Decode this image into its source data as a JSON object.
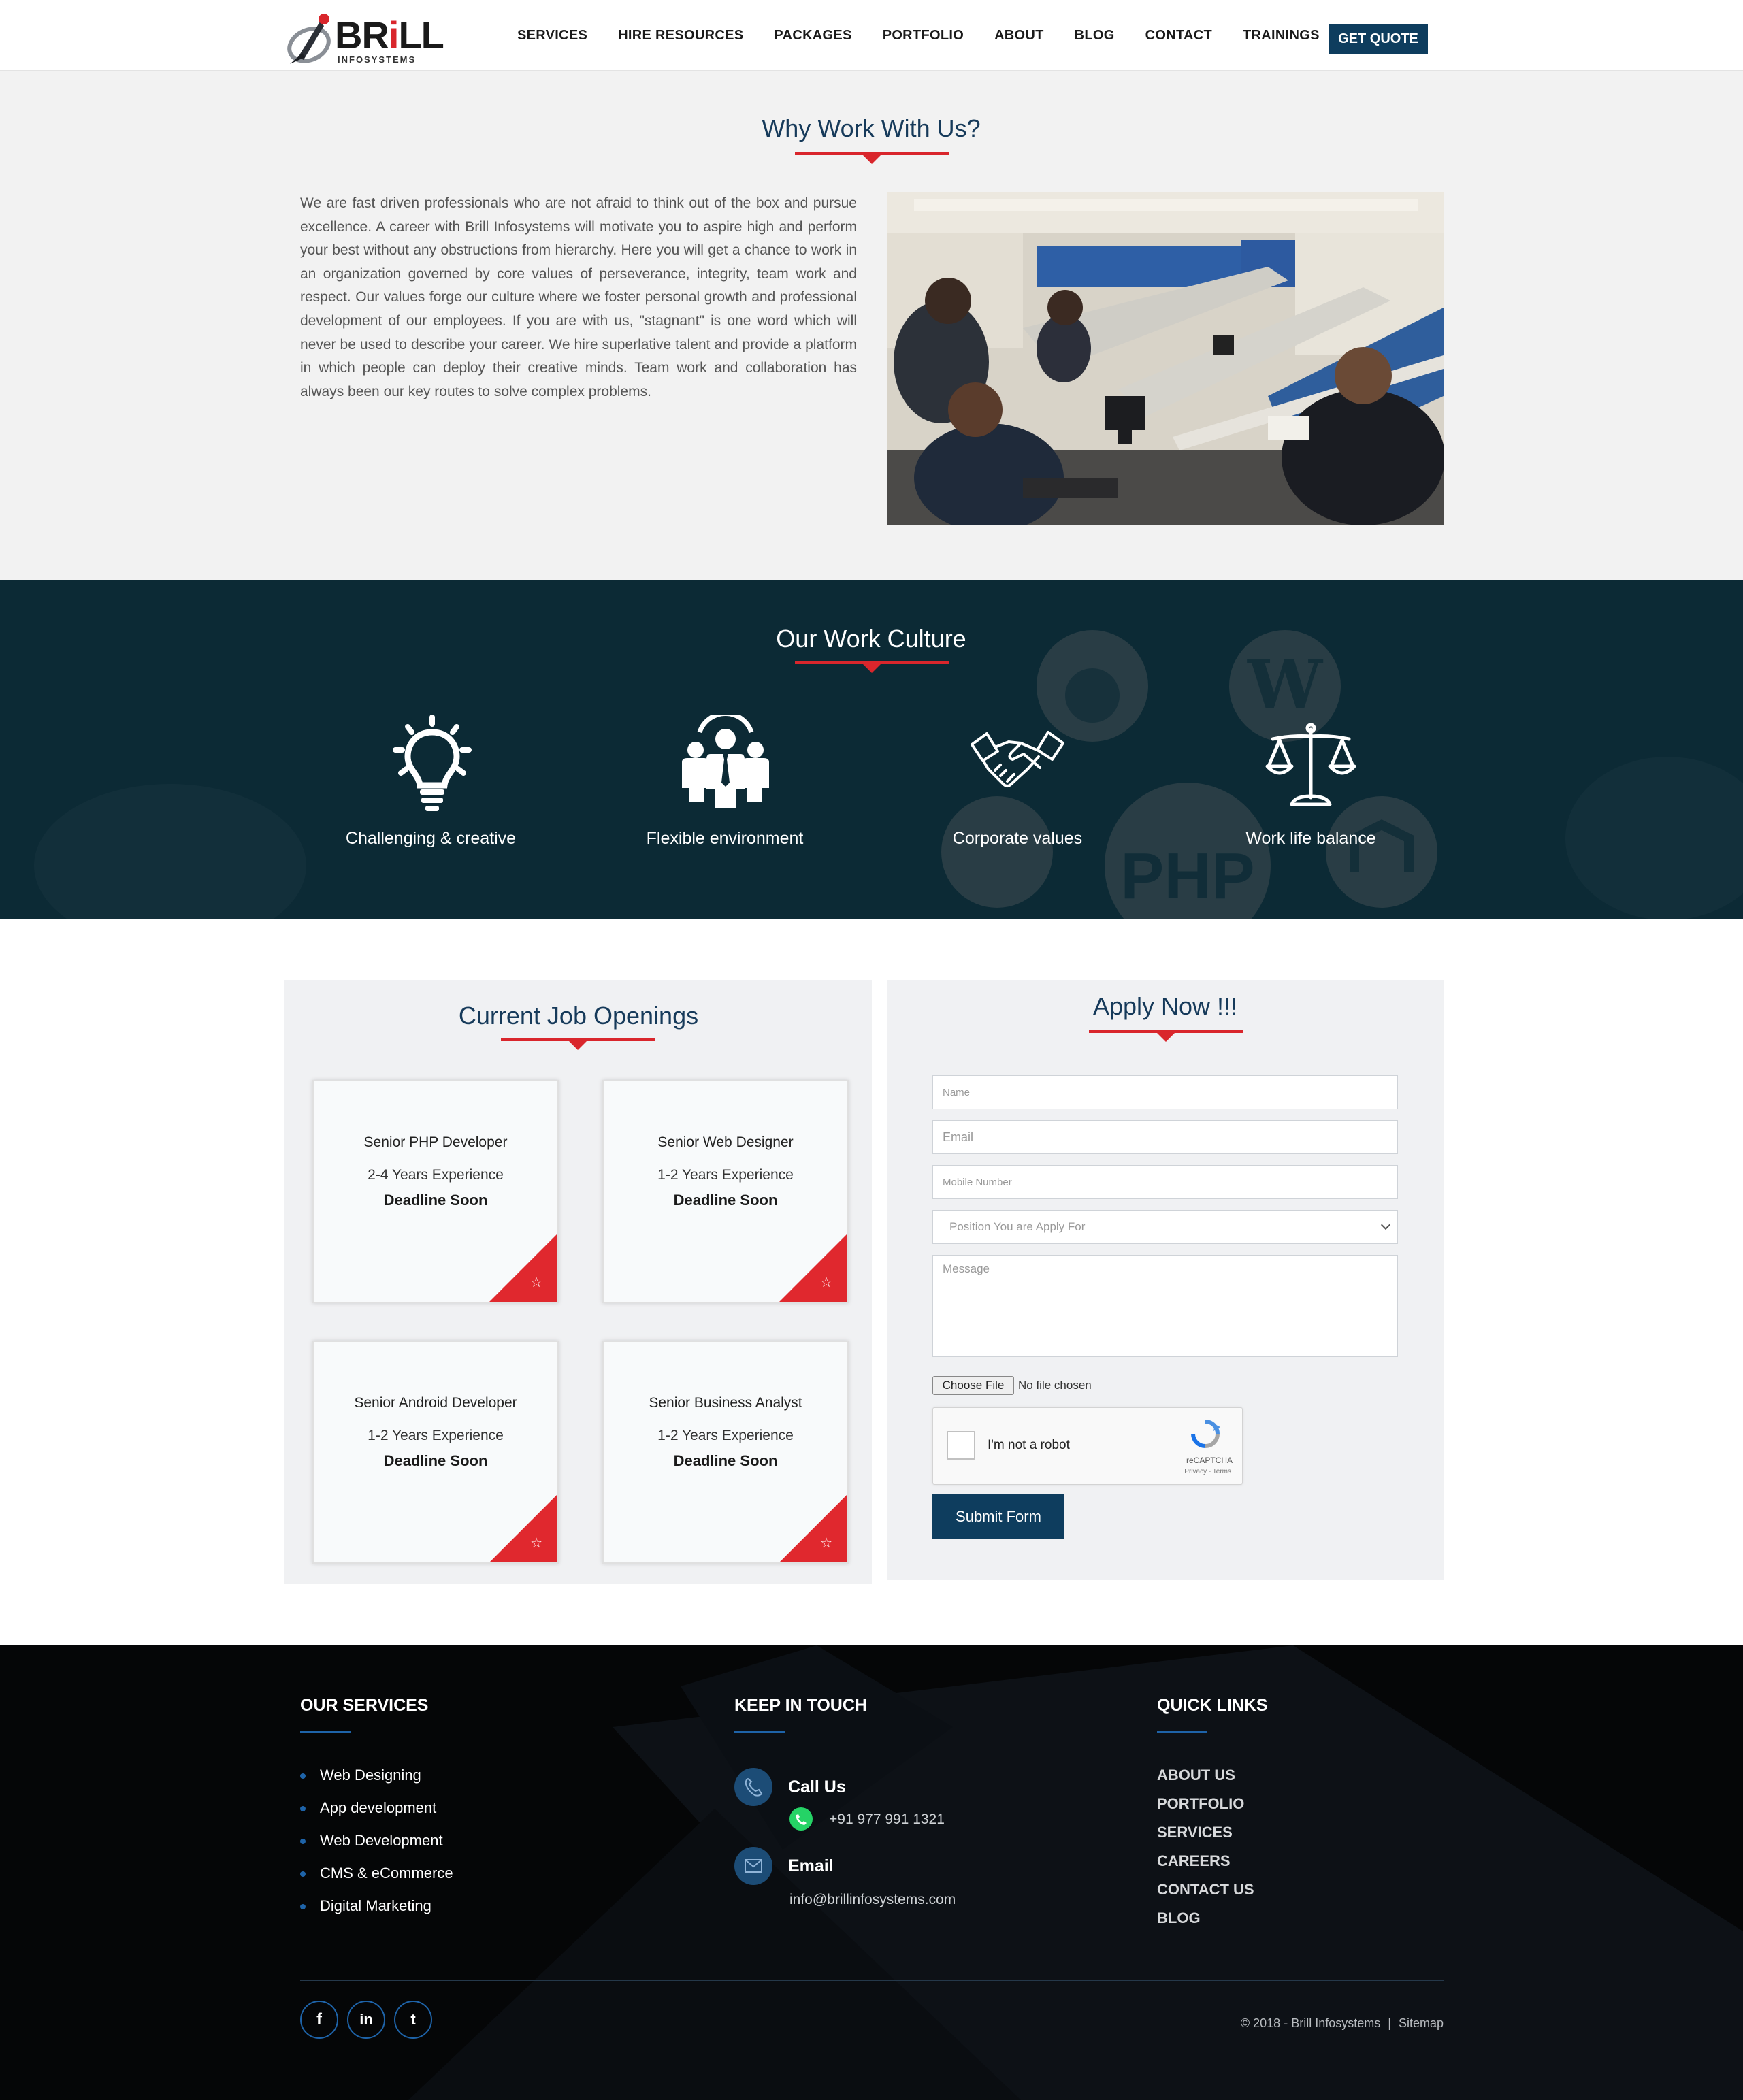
{
  "header": {
    "logo_text_main": "BR",
    "logo_text_accent": "i",
    "logo_text_end": "LL",
    "logo_subtitle": "INFOSYSTEMS",
    "nav": [
      "SERVICES",
      "HIRE RESOURCES",
      "PACKAGES",
      "PORTFOLIO",
      "ABOUT",
      "BLOG",
      "CONTACT",
      "TRAININGS"
    ],
    "cta": "GET QUOTE"
  },
  "why": {
    "title": "Why Work With Us?",
    "body": "We are fast driven professionals who are not afraid to think out of the box and pursue excellence. A career with Brill Infosystems will motivate you to aspire high and perform your best without any obstructions from hierarchy. Here you will get a chance to work in an organization governed by core values of perseverance, integrity, team work and respect. Our values forge our culture where we foster personal growth and professional development of our employees. If you are with us, \"stagnant\" is one word which will never be used to describe your career. We hire superlative talent and provide a platform in which people can deploy their creative minds. Team work and collaboration has always been our key routes to solve complex problems."
  },
  "culture": {
    "title": "Our Work Culture",
    "items": [
      {
        "label": "Challenging & creative",
        "icon": "lightbulb-icon"
      },
      {
        "label": "Flexible environment",
        "icon": "team-icon"
      },
      {
        "label": "Corporate values",
        "icon": "handshake-icon"
      },
      {
        "label": "Work life balance",
        "icon": "scales-icon"
      }
    ],
    "bg_text": "PHP"
  },
  "jobs": {
    "title": "Current Job Openings",
    "openings": [
      {
        "title": "Senior PHP Developer",
        "experience": "2-4 Years Experience",
        "deadline": "Deadline Soon"
      },
      {
        "title": "Senior Web Designer",
        "experience": "1-2 Years Experience",
        "deadline": "Deadline Soon"
      },
      {
        "title": "Senior Android Developer",
        "experience": "1-2 Years Experience",
        "deadline": "Deadline Soon"
      },
      {
        "title": "Senior Business Analyst",
        "experience": "1-2 Years Experience",
        "deadline": "Deadline Soon"
      }
    ]
  },
  "apply": {
    "title": "Apply Now !!!",
    "name_placeholder": "Name",
    "email_placeholder": "Email",
    "mobile_placeholder": "Mobile Number",
    "position_selected": "Position You are Apply For",
    "message_placeholder": "Message",
    "file_button": "Choose File",
    "file_status": "No file chosen",
    "captcha_label": "I'm not a robot",
    "captcha_brand": "reCAPTCHA",
    "captcha_terms": "Privacy - Terms",
    "submit": "Submit Form"
  },
  "footer": {
    "services_title": "OUR SERVICES",
    "services": [
      "Web Designing",
      "App development",
      "Web Development",
      "CMS & eCommerce",
      "Digital Marketing"
    ],
    "touch_title": "KEEP IN TOUCH",
    "call_label": "Call Us",
    "phone": "+91 977 991 1321",
    "email_label": "Email",
    "email": "info@brillinfosystems.com",
    "links_title": "QUICK LINKS",
    "links": [
      "ABOUT US",
      "PORTFOLIO",
      "SERVICES",
      "CAREERS",
      "CONTACT US",
      "BLOG"
    ],
    "social": [
      {
        "icon": "facebook-icon",
        "glyph": "f"
      },
      {
        "icon": "linkedin-icon",
        "glyph": "in"
      },
      {
        "icon": "twitter-icon",
        "glyph": "t"
      }
    ],
    "copyright": "© 2018 - Brill Infosystems",
    "sitemap": "Sitemap",
    "separator": "|"
  },
  "colors": {
    "brand_navy": "#0e3d5e",
    "accent_red": "#d9262c",
    "culture_bg": "#0c2a35",
    "footer_bg": "#050607",
    "footer_accent": "#1e63a8"
  }
}
